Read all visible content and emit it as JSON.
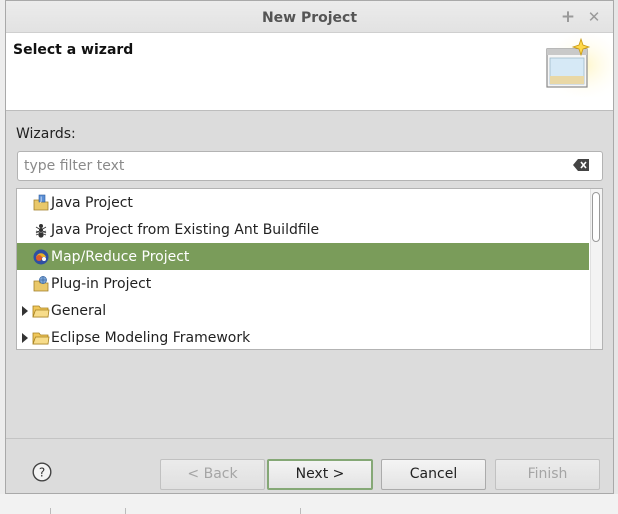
{
  "window": {
    "title": "New Project",
    "add_glyph": "+",
    "close_glyph": "✕"
  },
  "header": {
    "title": "Select a wizard",
    "banner_icon": "new-wizard-banner-icon"
  },
  "wizards": {
    "label": "Wizards:",
    "filter_placeholder": "type filter text",
    "filter_value": ""
  },
  "tree": {
    "selected_color": "#7a9c5a",
    "items": [
      {
        "label": "Java Project",
        "icon": "java-project-icon",
        "expandable": false,
        "selected": false
      },
      {
        "label": "Java Project from Existing Ant Buildfile",
        "icon": "ant-icon",
        "expandable": false,
        "selected": false
      },
      {
        "label": "Map/Reduce Project",
        "icon": "map-reduce-icon",
        "expandable": false,
        "selected": true
      },
      {
        "label": "Plug-in Project",
        "icon": "plugin-project-icon",
        "expandable": false,
        "selected": false
      },
      {
        "label": "General",
        "icon": "folder-icon",
        "expandable": true,
        "selected": false
      },
      {
        "label": "Eclipse Modeling Framework",
        "icon": "folder-icon",
        "expandable": true,
        "selected": false
      }
    ]
  },
  "buttons": {
    "help": "?",
    "back": "< Back",
    "next": "Next >",
    "cancel": "Cancel",
    "finish": "Finish"
  }
}
